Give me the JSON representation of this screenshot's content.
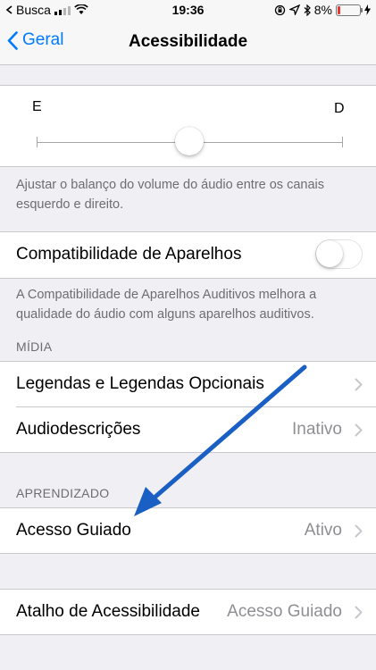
{
  "status_bar": {
    "carrier": "Busca",
    "time": "19:36",
    "battery_percent": "8%",
    "battery_color": "#e53935"
  },
  "nav": {
    "back_label": "Geral",
    "title": "Acessibilidade"
  },
  "balance": {
    "left_letter": "E",
    "right_letter": "D",
    "slider_value": 0.5,
    "footer": "Ajustar o balanço do volume do áudio entre os canais esquerdo e direito."
  },
  "hearing_aid": {
    "label": "Compatibilidade de Aparelhos",
    "toggle_on": false,
    "footer": "A Compatibilidade de Aparelhos Auditivos melhora a qualidade do áudio com alguns aparelhos auditivos."
  },
  "media": {
    "header": "MÍDIA",
    "items": [
      {
        "label": "Legendas e Legendas Opcionais",
        "value": ""
      },
      {
        "label": "Audiodescrições",
        "value": "Inativo"
      }
    ]
  },
  "learning": {
    "header": "APRENDIZADO",
    "items": [
      {
        "label": "Acesso Guiado",
        "value": "Ativo"
      }
    ]
  },
  "shortcut": {
    "label": "Atalho de Acessibilidade",
    "value": "Acesso Guiado"
  },
  "colors": {
    "accent": "#007aff",
    "annotation_arrow": "#1a5fc4"
  }
}
